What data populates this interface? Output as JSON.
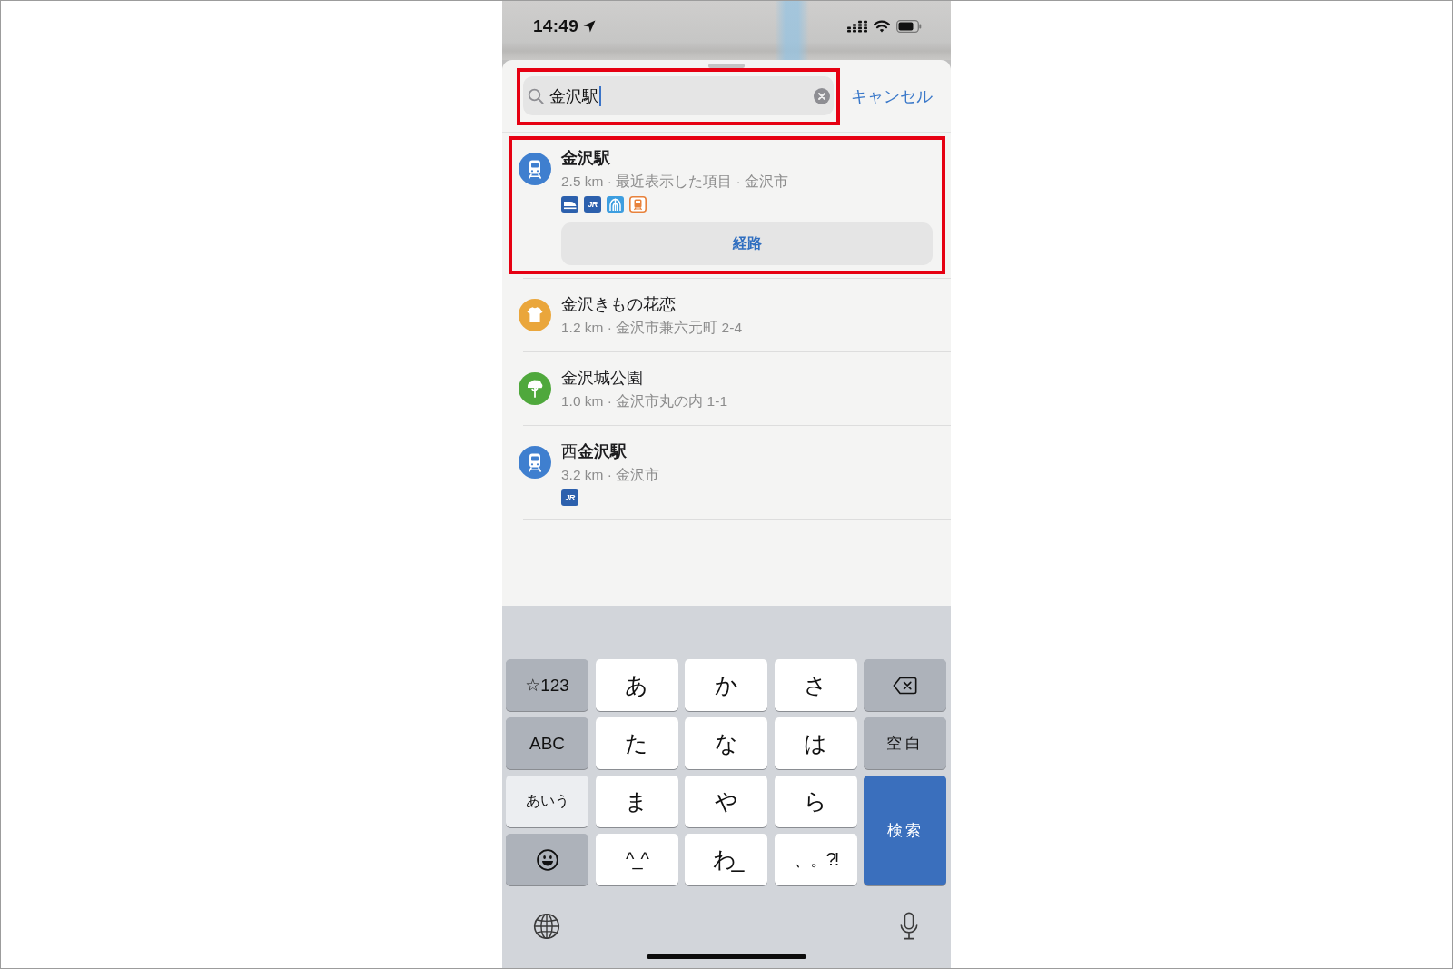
{
  "status_bar": {
    "time": "14:49"
  },
  "search": {
    "value": "金沢駅",
    "highlighted": true,
    "cancel": "キャンセル"
  },
  "results": [
    {
      "kind": "station",
      "color": "#3f7fcf",
      "title": "金沢駅",
      "title_bold": true,
      "subtitle": "2.5 km · 最近表示した項目 · 金沢市",
      "badges": [
        {
          "kind": "bullet-train",
          "color": "#2c60ad"
        },
        {
          "kind": "text",
          "label": "JR",
          "color": "#2c60ad"
        },
        {
          "kind": "arch",
          "color": "#3d9ee0"
        },
        {
          "kind": "train-outline",
          "color": "#e8823c"
        }
      ],
      "action": "経路",
      "highlighted": true
    },
    {
      "kind": "clothing",
      "color": "#eaa63b",
      "title": "金沢きもの花恋",
      "title_bold": false,
      "subtitle": "1.2 km · 金沢市兼六元町 2-4",
      "highlighted": false
    },
    {
      "kind": "park",
      "color": "#4fa83c",
      "title": "金沢城公園",
      "title_bold": false,
      "subtitle": "1.0 km · 金沢市丸の内 1-1",
      "highlighted": false
    },
    {
      "kind": "station",
      "color": "#3f7fcf",
      "title": "西**金沢駅**",
      "title_bold": false,
      "subtitle": "3.2 km · 金沢市",
      "badges": [
        {
          "kind": "text",
          "label": "JR",
          "color": "#2c60ad"
        }
      ],
      "highlighted": false
    }
  ],
  "keyboard": {
    "keys": [
      {
        "kind": "mode",
        "label": "☆123",
        "selected": false
      },
      {
        "kind": "char",
        "label": "あ"
      },
      {
        "kind": "char",
        "label": "か"
      },
      {
        "kind": "char",
        "label": "さ"
      },
      {
        "kind": "delete"
      },
      {
        "kind": "mode",
        "label": "ABC",
        "selected": false
      },
      {
        "kind": "char",
        "label": "た"
      },
      {
        "kind": "char",
        "label": "な"
      },
      {
        "kind": "char",
        "label": "は"
      },
      {
        "kind": "space",
        "label": "空白"
      },
      {
        "kind": "mode",
        "label": "あいう",
        "selected": true
      },
      {
        "kind": "char",
        "label": "ま"
      },
      {
        "kind": "char",
        "label": "や"
      },
      {
        "kind": "char",
        "label": "ら"
      },
      {
        "kind": "return",
        "label": "検索"
      },
      {
        "kind": "emoji"
      },
      {
        "kind": "char",
        "label": "^_^"
      },
      {
        "kind": "char",
        "label": "わ_"
      },
      {
        "kind": "char",
        "label": "、。?!"
      }
    ]
  }
}
